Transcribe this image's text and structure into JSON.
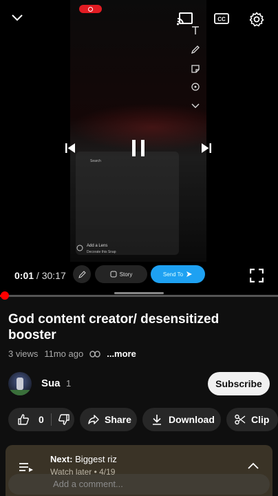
{
  "player": {
    "current_time": "0:01",
    "duration": "/ 30:17",
    "progress_fraction": 0.0006,
    "overlay": {
      "story_label": "Story",
      "send_to_label": "Send To",
      "lens_title": "Add a Lens",
      "lens_sub": "Decorate this Snap",
      "search_text": "Search"
    }
  },
  "video": {
    "title": "God content creator/ desensitized booster",
    "views": "3 views",
    "age": "11mo ago",
    "more_label": "...more"
  },
  "channel": {
    "name": "Sua",
    "subscribers": "1",
    "subscribe_label": "Subscribe"
  },
  "actions": {
    "like_count": "0",
    "share_label": "Share",
    "download_label": "Download",
    "clip_label": "Clip"
  },
  "next": {
    "prefix": "Next:",
    "title": "Biggest riz",
    "sub": "Watch later • 4/19"
  },
  "comments": {
    "placeholder": "Add a comment..."
  },
  "colors": {
    "accent": "#ff0000",
    "background": "#0f0f0f",
    "pill": "#272727",
    "send_to": "#1ea1f2",
    "next_bar": "#3a3326"
  }
}
